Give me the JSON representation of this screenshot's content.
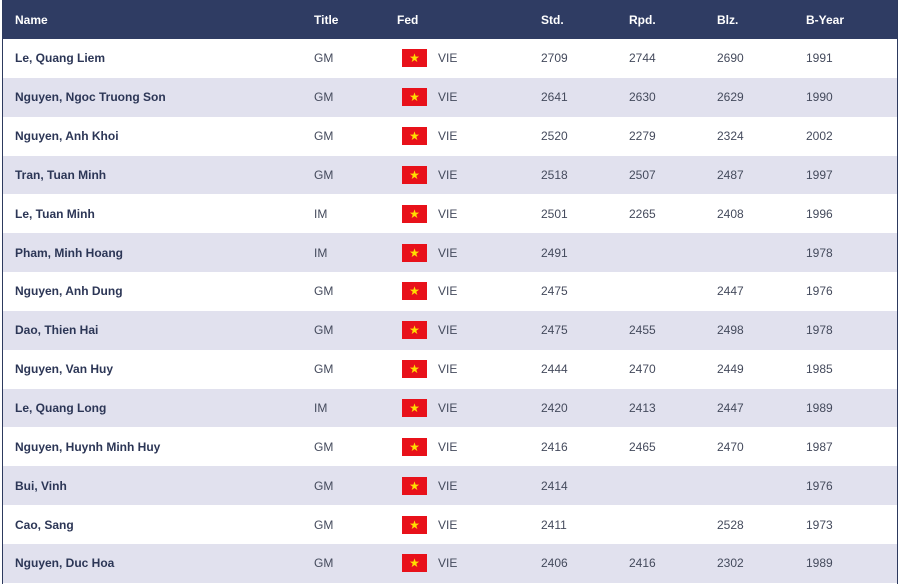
{
  "colors": {
    "header_bg": "#2f3c63",
    "row_alt_bg": "#e1e1ee",
    "flag_red": "#e8111a",
    "flag_star": "#ffde00"
  },
  "table": {
    "headers": {
      "name": "Name",
      "title": "Title",
      "fed": "Fed",
      "std": "Std.",
      "rpd": "Rpd.",
      "blz": "Blz.",
      "byear": "B-Year"
    },
    "rows": [
      {
        "name": "Le, Quang Liem",
        "title": "GM",
        "fed_icon": "vietnam-flag-icon",
        "fed": "VIE",
        "std": "2709",
        "rpd": "2744",
        "blz": "2690",
        "byear": "1991"
      },
      {
        "name": "Nguyen, Ngoc Truong Son",
        "title": "GM",
        "fed_icon": "vietnam-flag-icon",
        "fed": "VIE",
        "std": "2641",
        "rpd": "2630",
        "blz": "2629",
        "byear": "1990"
      },
      {
        "name": "Nguyen, Anh Khoi",
        "title": "GM",
        "fed_icon": "vietnam-flag-icon",
        "fed": "VIE",
        "std": "2520",
        "rpd": "2279",
        "blz": "2324",
        "byear": "2002"
      },
      {
        "name": "Tran, Tuan Minh",
        "title": "GM",
        "fed_icon": "vietnam-flag-icon",
        "fed": "VIE",
        "std": "2518",
        "rpd": "2507",
        "blz": "2487",
        "byear": "1997"
      },
      {
        "name": "Le, Tuan Minh",
        "title": "IM",
        "fed_icon": "vietnam-flag-icon",
        "fed": "VIE",
        "std": "2501",
        "rpd": "2265",
        "blz": "2408",
        "byear": "1996"
      },
      {
        "name": "Pham, Minh Hoang",
        "title": "IM",
        "fed_icon": "vietnam-flag-icon",
        "fed": "VIE",
        "std": "2491",
        "rpd": "",
        "blz": "",
        "byear": "1978"
      },
      {
        "name": "Nguyen, Anh Dung",
        "title": "GM",
        "fed_icon": "vietnam-flag-icon",
        "fed": "VIE",
        "std": "2475",
        "rpd": "",
        "blz": "2447",
        "byear": "1976"
      },
      {
        "name": "Dao, Thien Hai",
        "title": "GM",
        "fed_icon": "vietnam-flag-icon",
        "fed": "VIE",
        "std": "2475",
        "rpd": "2455",
        "blz": "2498",
        "byear": "1978"
      },
      {
        "name": "Nguyen, Van Huy",
        "title": "GM",
        "fed_icon": "vietnam-flag-icon",
        "fed": "VIE",
        "std": "2444",
        "rpd": "2470",
        "blz": "2449",
        "byear": "1985"
      },
      {
        "name": "Le, Quang Long",
        "title": "IM",
        "fed_icon": "vietnam-flag-icon",
        "fed": "VIE",
        "std": "2420",
        "rpd": "2413",
        "blz": "2447",
        "byear": "1989"
      },
      {
        "name": "Nguyen, Huynh Minh Huy",
        "title": "GM",
        "fed_icon": "vietnam-flag-icon",
        "fed": "VIE",
        "std": "2416",
        "rpd": "2465",
        "blz": "2470",
        "byear": "1987"
      },
      {
        "name": "Bui, Vinh",
        "title": "GM",
        "fed_icon": "vietnam-flag-icon",
        "fed": "VIE",
        "std": "2414",
        "rpd": "",
        "blz": "",
        "byear": "1976"
      },
      {
        "name": "Cao, Sang",
        "title": "GM",
        "fed_icon": "vietnam-flag-icon",
        "fed": "VIE",
        "std": "2411",
        "rpd": "",
        "blz": "2528",
        "byear": "1973"
      },
      {
        "name": "Nguyen, Duc Hoa",
        "title": "GM",
        "fed_icon": "vietnam-flag-icon",
        "fed": "VIE",
        "std": "2406",
        "rpd": "2416",
        "blz": "2302",
        "byear": "1989"
      }
    ]
  }
}
